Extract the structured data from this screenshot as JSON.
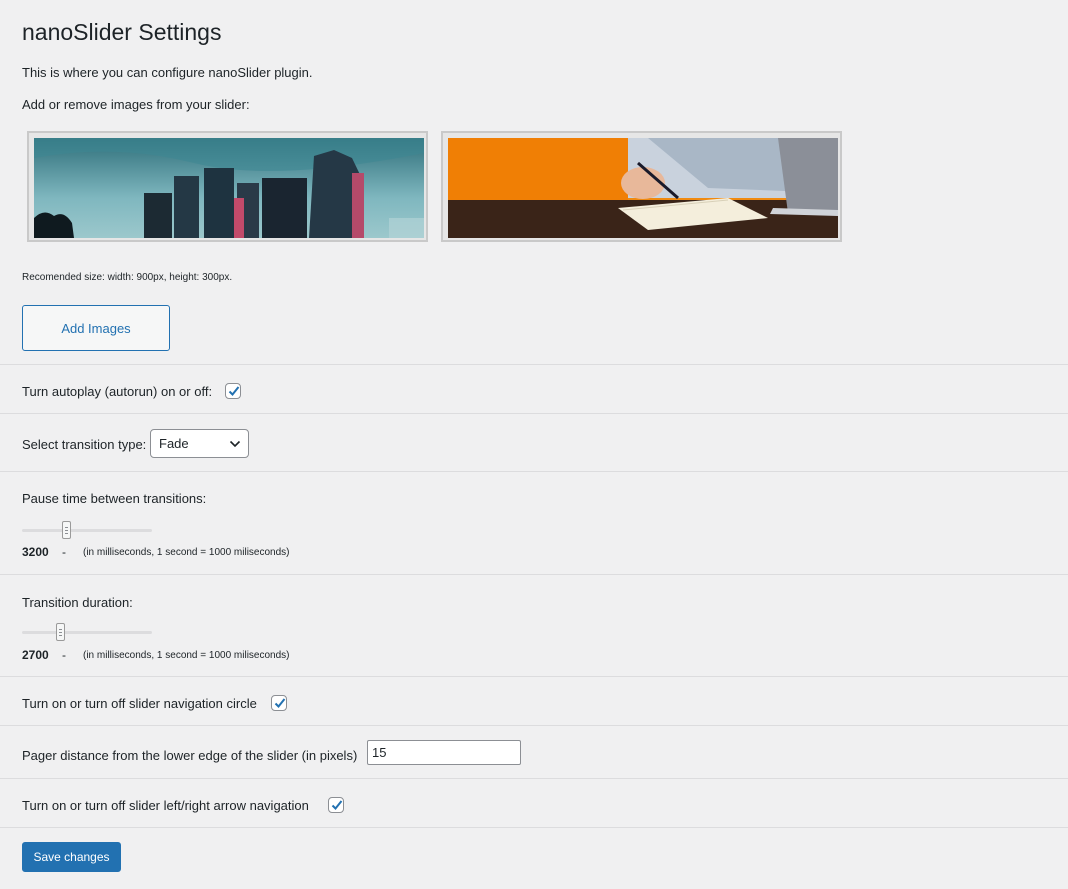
{
  "page": {
    "title": "nanoSlider Settings",
    "intro": "This is where you can configure nanoSlider plugin.",
    "images_label": "Add or remove images from your slider:",
    "recommended_size": "Recomended size: width: 900px, height: 300px.",
    "add_images_label": "Add Images"
  },
  "images": [
    {
      "name": "city-skyline-image"
    },
    {
      "name": "writing-notebook-image"
    }
  ],
  "settings": {
    "autoplay": {
      "label": "Turn autoplay (autorun) on or off:",
      "checked": true
    },
    "transition": {
      "label": "Select transition type:",
      "selected": "Fade"
    },
    "pause": {
      "label": "Pause time between transitions:",
      "value": "3200",
      "dash": "-",
      "note": "(in milliseconds, 1 second = 1000 miliseconds)"
    },
    "duration": {
      "label": "Transition duration:",
      "value": "2700",
      "dash": "-",
      "note": "(in milliseconds, 1 second = 1000 miliseconds)"
    },
    "nav_circle": {
      "label": "Turn on or turn off slider navigation circle",
      "checked": true
    },
    "pager_distance": {
      "label": "Pager distance from the lower edge of the slider (in pixels)",
      "value": "15"
    },
    "arrows": {
      "label": "Turn on or turn off slider left/right arrow navigation",
      "checked": true
    }
  },
  "save_label": "Save changes",
  "colors": {
    "accent": "#2271b1",
    "background": "#f0f0f1"
  }
}
